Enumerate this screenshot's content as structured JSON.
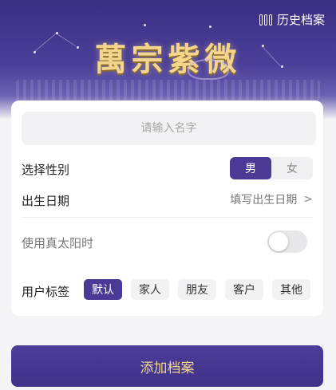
{
  "header": {
    "history_label": "历史档案",
    "logo_text": "萬宗紫微"
  },
  "form": {
    "name_placeholder": "请输入名字",
    "gender_label": "选择性别",
    "gender_options": [
      "男",
      "女"
    ],
    "gender_selected": "男",
    "birth_label": "出生日期",
    "birth_placeholder": "填写出生日期",
    "solar_time_label": "使用真太阳时",
    "solar_time_enabled": false,
    "tag_label": "用户标签",
    "tags": [
      "默认",
      "家人",
      "朋友",
      "客户",
      "其他"
    ],
    "tag_selected": "默认"
  },
  "actions": {
    "add_label": "添加档案"
  },
  "colors": {
    "primary": "#4a3a96",
    "gold": "#f3d68b"
  }
}
